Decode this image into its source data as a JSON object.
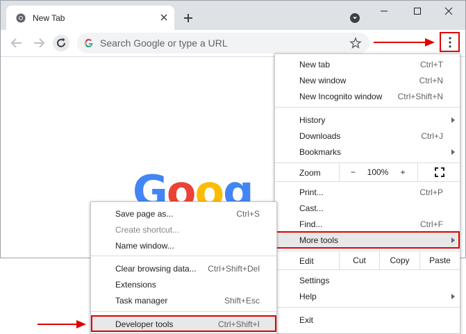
{
  "tab": {
    "title": "New Tab"
  },
  "omnibox": {
    "placeholder": "Search Google or type a URL"
  },
  "logo": {
    "letters": [
      "G",
      "o",
      "o",
      "g"
    ],
    "colors": [
      "#4285f4",
      "#ea4335",
      "#fbbc05",
      "#4285f4"
    ]
  },
  "main_menu": {
    "group1": [
      {
        "label": "New tab",
        "shortcut": "Ctrl+T"
      },
      {
        "label": "New window",
        "shortcut": "Ctrl+N"
      },
      {
        "label": "New Incognito window",
        "shortcut": "Ctrl+Shift+N"
      }
    ],
    "group2": [
      {
        "label": "History",
        "shortcut": ""
      },
      {
        "label": "Downloads",
        "shortcut": "Ctrl+J"
      },
      {
        "label": "Bookmarks",
        "shortcut": ""
      }
    ],
    "zoom": {
      "label": "Zoom",
      "minus": "−",
      "value": "100%",
      "plus": "+"
    },
    "group3": [
      {
        "label": "Print...",
        "shortcut": "Ctrl+P"
      },
      {
        "label": "Cast...",
        "shortcut": ""
      },
      {
        "label": "Find...",
        "shortcut": "Ctrl+F"
      },
      {
        "label": "More tools",
        "shortcut": ""
      }
    ],
    "edit": {
      "label": "Edit",
      "cut": "Cut",
      "copy": "Copy",
      "paste": "Paste"
    },
    "group4": [
      {
        "label": "Settings",
        "shortcut": ""
      },
      {
        "label": "Help",
        "shortcut": ""
      }
    ],
    "exit": {
      "label": "Exit"
    }
  },
  "sub_menu": {
    "group1": [
      {
        "label": "Save page as...",
        "shortcut": "Ctrl+S"
      },
      {
        "label": "Create shortcut...",
        "shortcut": ""
      },
      {
        "label": "Name window...",
        "shortcut": ""
      }
    ],
    "group2": [
      {
        "label": "Clear browsing data...",
        "shortcut": "Ctrl+Shift+Del"
      },
      {
        "label": "Extensions",
        "shortcut": ""
      },
      {
        "label": "Task manager",
        "shortcut": "Shift+Esc"
      }
    ],
    "group3": [
      {
        "label": "Developer tools",
        "shortcut": "Ctrl+Shift+I"
      }
    ]
  },
  "colors": {
    "arrow": "#e00000",
    "highlight_box": "#e00000",
    "menu_hover": "#e8e8e8"
  }
}
